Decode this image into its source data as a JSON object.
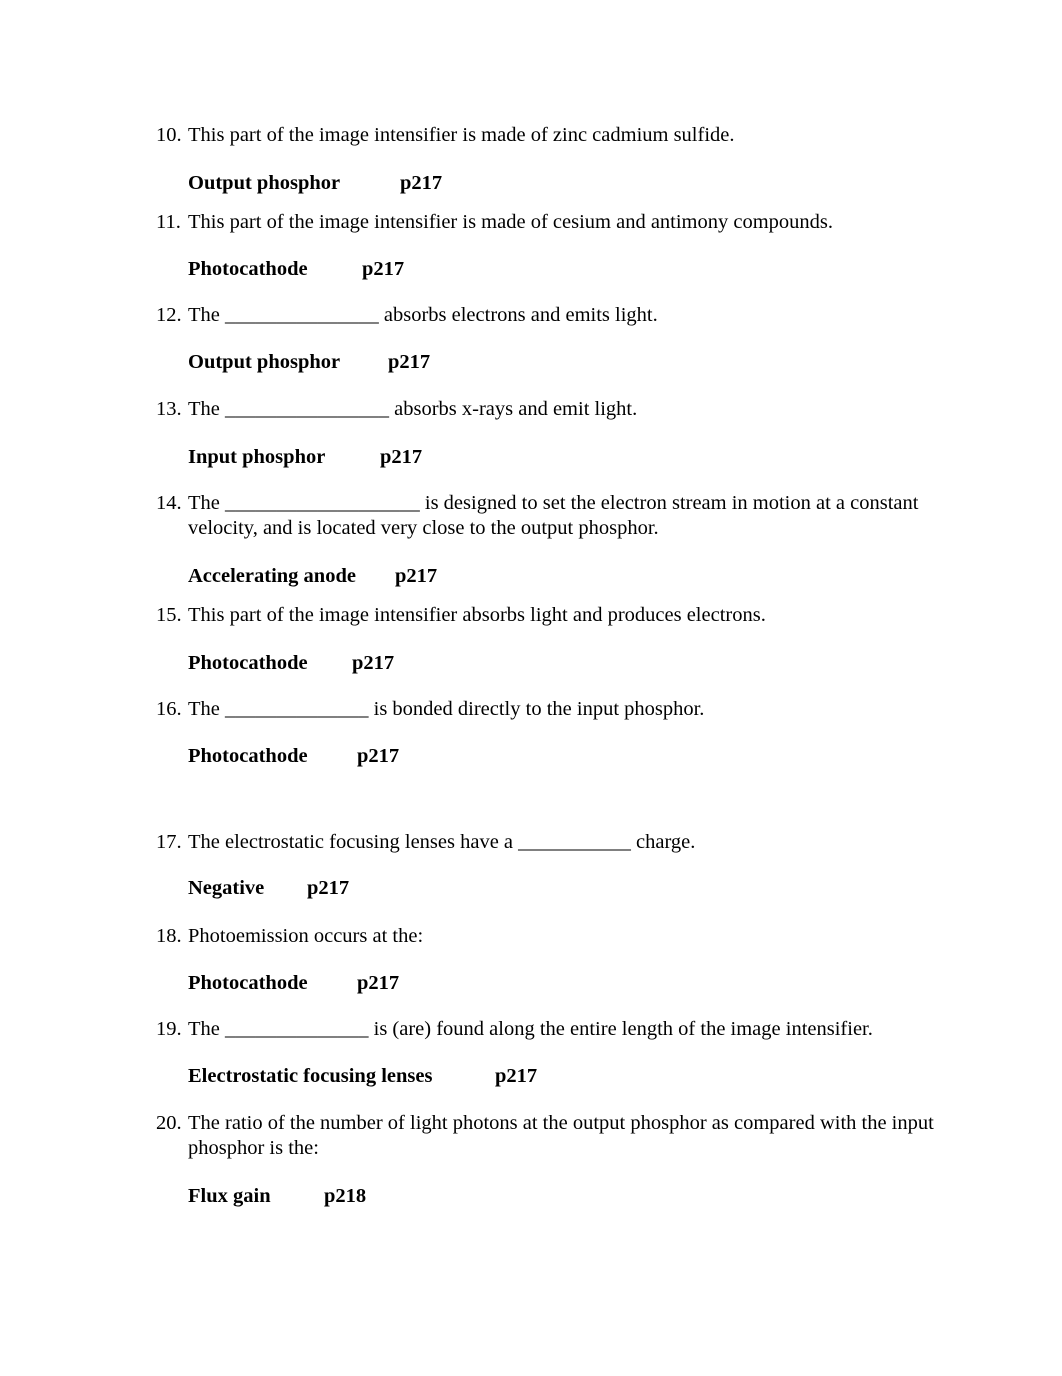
{
  "questions": [
    {
      "number": "10.",
      "text": "This part of the image intensifier is made of zinc cadmium sulfide.",
      "answer": "Output phosphor",
      "page": "p217"
    },
    {
      "number": "11.",
      "text": "This part of the image intensifier is made of cesium and antimony compounds.",
      "answer": "Photocathode",
      "page": "p217"
    },
    {
      "number": "12.",
      "text": "The _______________ absorbs electrons and emits light.",
      "answer": "Output phosphor",
      "page": "p217"
    },
    {
      "number": "13.",
      "text": "The ________________ absorbs x-rays and emit light.",
      "answer": "Input phosphor",
      "page": "p217"
    },
    {
      "number": "14.",
      "text": "The ___________________ is designed to set the electron stream in motion at a constant velocity, and is located very close to the output phosphor.",
      "answer": "Accelerating anode",
      "page": "p217"
    },
    {
      "number": "15.",
      "text": "This part of the image intensifier absorbs light and produces electrons.",
      "answer": "Photocathode",
      "page": "p217"
    },
    {
      "number": "16.",
      "text": "The ______________ is bonded directly to the input phosphor.",
      "answer": "Photocathode",
      "page": "p217"
    },
    {
      "number": "17.",
      "text": "The electrostatic focusing lenses have a ___________ charge.",
      "answer": "Negative",
      "page": "p217"
    },
    {
      "number": "18.",
      "text": "Photoemission occurs at the:",
      "answer": "Photocathode",
      "page": "p217"
    },
    {
      "number": "19.",
      "text": "The ______________ is (are) found along the entire length of the image intensifier.",
      "answer": "Electrostatic focusing lenses",
      "page": "p217"
    },
    {
      "number": "20.",
      "text": "The ratio of the number of light photons at the output phosphor as compared with the input phosphor is the:",
      "answer": "Flux gain",
      "page": "p218"
    }
  ]
}
